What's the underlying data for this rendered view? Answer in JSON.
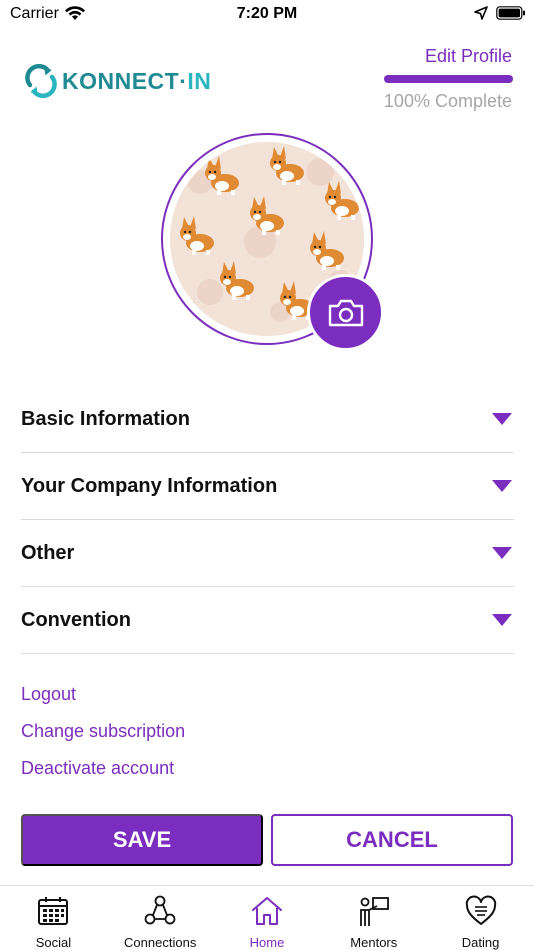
{
  "status_bar": {
    "carrier": "Carrier",
    "time": "7:20 PM",
    "icons": [
      "wifi-icon",
      "location-arrow-icon",
      "battery-icon"
    ]
  },
  "header": {
    "logo_text_primary": "KONNECT",
    "logo_text_dot": "·",
    "logo_text_accent": "IN",
    "edit_profile": "Edit Profile",
    "progress_percent": 100,
    "progress_label": "100% Complete"
  },
  "avatar": {
    "camera_icon": "camera-icon"
  },
  "sections": [
    {
      "label": "Basic Information"
    },
    {
      "label": "Your Company Information"
    },
    {
      "label": "Other"
    },
    {
      "label": "Convention"
    }
  ],
  "links": {
    "logout": "Logout",
    "change_subscription": "Change subscription",
    "deactivate": "Deactivate account"
  },
  "actions": {
    "save": "SAVE",
    "cancel": "CANCEL"
  },
  "tabs": [
    {
      "label": "Social",
      "icon": "calendar-icon"
    },
    {
      "label": "Connections",
      "icon": "network-people-icon"
    },
    {
      "label": "Home",
      "icon": "home-icon",
      "active": true
    },
    {
      "label": "Mentors",
      "icon": "mentor-presenter-icon"
    },
    {
      "label": "Dating",
      "icon": "heart-chat-icon"
    }
  ],
  "colors": {
    "accent": "#7b2dbf",
    "logo": "#1f8a93",
    "muted": "#a6a6a6",
    "divider": "#dcdcdc"
  }
}
